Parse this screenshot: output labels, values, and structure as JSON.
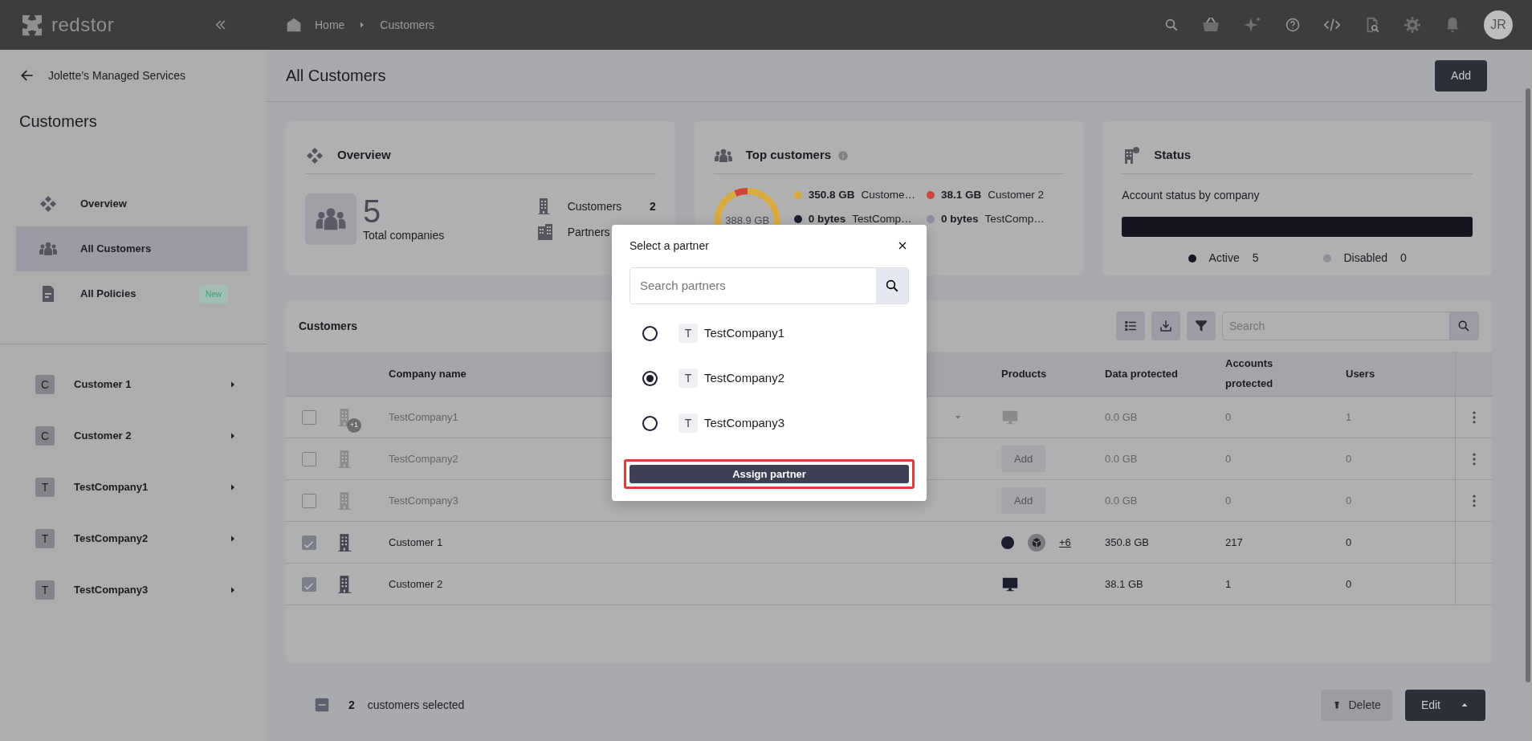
{
  "topbar": {
    "brand": "redstor",
    "breadcrumbs": [
      "Home",
      "Customers"
    ],
    "avatar": "JR"
  },
  "sidebar": {
    "back_label": "Jolette’s Managed Services",
    "title": "Customers",
    "nav": [
      {
        "kind": "overview",
        "label": "Overview",
        "selected": false
      },
      {
        "kind": "customers",
        "label": "All Customers",
        "selected": true
      },
      {
        "kind": "policies",
        "label": "All Policies",
        "badge": "New",
        "selected": false
      }
    ],
    "companies": [
      {
        "initial": "C",
        "label": "Customer 1"
      },
      {
        "initial": "C",
        "label": "Customer 2"
      },
      {
        "initial": "T",
        "label": "TestCompany1"
      },
      {
        "initial": "T",
        "label": "TestCompany2"
      },
      {
        "initial": "T",
        "label": "TestCompany3"
      }
    ]
  },
  "page": {
    "title": "All Customers",
    "add_button": "Add"
  },
  "overview": {
    "title": "Overview",
    "count": "5",
    "count_label": "Total companies",
    "stats": [
      {
        "label": "Customers",
        "value": "2"
      },
      {
        "label": "Partners"
      }
    ]
  },
  "top_customers": {
    "title": "Top customers",
    "total": "388.9 GB",
    "legend": [
      {
        "value": "350.8 GB",
        "label": "Custome…",
        "color": "#d9aa3f"
      },
      {
        "value": "38.1 GB",
        "label": "Customer 2",
        "color": "#c9473f"
      },
      {
        "value": "0 bytes",
        "label": "TestComp…",
        "color": "#1b1d2e"
      },
      {
        "value": "0 bytes",
        "label": "TestComp…",
        "color": "#8c8e9c"
      }
    ]
  },
  "status": {
    "title": "Status",
    "subtitle": "Account status by company",
    "level": 1,
    "legend": [
      {
        "label": "Active",
        "value": "5",
        "color": "#15161f"
      },
      {
        "label": "Disabled",
        "value": "0",
        "color": "#8e8f96"
      }
    ]
  },
  "customers_table": {
    "title": "Customers",
    "search_placeholder": "Search",
    "columns": [
      "Company name",
      "Products",
      "Data protected",
      "Accounts protected",
      "Users"
    ],
    "rows": [
      {
        "checked": false,
        "disabled": true,
        "badge": "+1",
        "name": "TestCompany1",
        "dropdown": true,
        "products": {
          "kind": "monitor"
        },
        "data": "0.0 GB",
        "accounts": "0",
        "users": "1",
        "menu": true
      },
      {
        "checked": false,
        "disabled": true,
        "name": "TestCompany2",
        "products": {
          "kind": "add",
          "label": "Add"
        },
        "data": "0.0 GB",
        "accounts": "0",
        "users": "0",
        "menu": true
      },
      {
        "checked": false,
        "disabled": true,
        "name": "TestCompany3",
        "products": {
          "kind": "add",
          "label": "Add"
        },
        "data": "0.0 GB",
        "accounts": "0",
        "users": "0",
        "menu": true
      },
      {
        "checked": true,
        "disabled": false,
        "name": "Customer 1",
        "products": {
          "kind": "icons",
          "more": "+6"
        },
        "data": "350.8 GB",
        "accounts": "217",
        "users": "0",
        "menu": false
      },
      {
        "checked": true,
        "disabled": false,
        "name": "Customer 2",
        "products": {
          "kind": "monitor"
        },
        "data": "38.1 GB",
        "accounts": "1",
        "users": "0",
        "menu": false
      }
    ]
  },
  "footer": {
    "count": "2",
    "label": "customers selected",
    "delete": "Delete",
    "edit": "Edit"
  },
  "modal": {
    "title": "Select a partner",
    "search_placeholder": "Search partners",
    "options": [
      {
        "initial": "T",
        "label": "TestCompany1",
        "selected": false
      },
      {
        "initial": "T",
        "label": "TestCompany2",
        "selected": true
      },
      {
        "initial": "T",
        "label": "TestCompany3",
        "selected": false
      }
    ],
    "submit": "Assign partner",
    "submit_highlighted": true
  }
}
